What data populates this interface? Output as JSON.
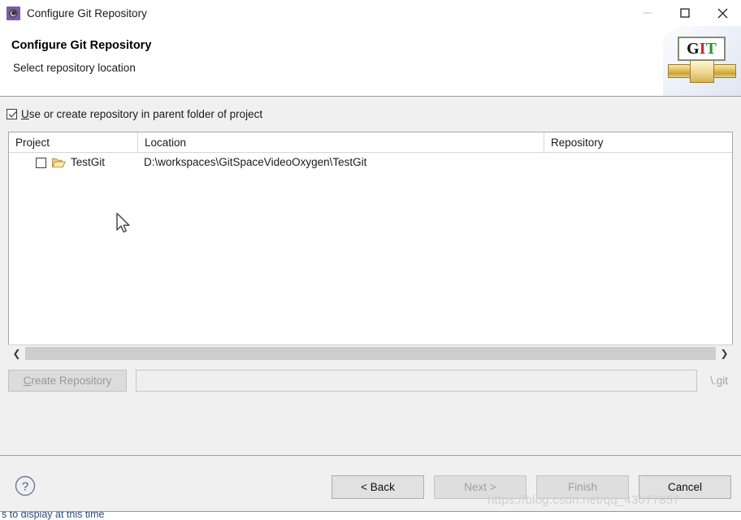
{
  "window": {
    "title": "Configure Git Repository",
    "icon": "git-config-icon",
    "controls": {
      "minimize": "minimize-icon",
      "maximize": "maximize-icon",
      "close": "close-icon"
    }
  },
  "header": {
    "title": "Configure Git Repository",
    "subtitle": "Select repository location",
    "logo": {
      "g": "G",
      "i": "I",
      "t": "T",
      "alt": "git-logo"
    }
  },
  "options": {
    "parent_folder": {
      "label_mnemonic": "U",
      "label_rest": "se or create repository in parent folder of project",
      "checked": true
    }
  },
  "table": {
    "columns": [
      "Project",
      "Location",
      "Repository"
    ],
    "rows": [
      {
        "checked": false,
        "icon": "folder-icon",
        "project": "TestGit",
        "location": "D:\\workspaces\\GitSpaceVideoOxygen\\TestGit",
        "repository": ""
      }
    ],
    "scrollbar": {
      "left_arrow": "chevron-left-icon",
      "right_arrow": "chevron-right-icon"
    }
  },
  "create_repository": {
    "button_mnemonic": "C",
    "button_rest": "reate Repository",
    "button_enabled": false,
    "path_value": "",
    "path_placeholder": "",
    "suffix_label": "\\.git"
  },
  "footer": {
    "help_icon": "help-icon",
    "buttons": [
      {
        "label": "< Back",
        "mnemonic": "B",
        "enabled": true
      },
      {
        "label": "Next >",
        "mnemonic": "N",
        "enabled": false
      },
      {
        "label": "Finish",
        "mnemonic": "F",
        "enabled": false
      },
      {
        "label": "Cancel",
        "mnemonic": "",
        "enabled": true
      }
    ]
  },
  "watermark": "https://blog.csdn.net/qq_43077857",
  "bottom_status": "s to display at this time",
  "colors": {
    "accent_purple": "#7d5ba6",
    "git_red": "#d22121",
    "git_green": "#1d9b2c",
    "dialog_bg": "#f0f0f0",
    "panel_white": "#ffffff",
    "disabled_text": "#a0a0a0"
  }
}
